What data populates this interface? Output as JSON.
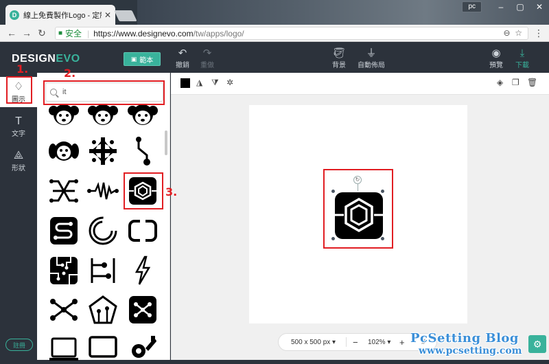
{
  "browser": {
    "tab_title": "線上免費製作Logo - 定制...",
    "favicon_letter": "D",
    "user_label": "pc",
    "secure_label": "安全",
    "url_host": "https://www.designevo.com",
    "url_path": "/tw/apps/logo/"
  },
  "app": {
    "brand_left": "DESIGN",
    "brand_right": "EVO",
    "save_label": "範本",
    "undo_label": "撤銷",
    "redo_label": "重做",
    "background_label": "背景",
    "autolayout_label": "自動佈局",
    "preview_label": "預覽",
    "download_label": "下載"
  },
  "rail": {
    "icon_label": "圖示",
    "text_label": "文字",
    "shape_label": "形狀",
    "signup_label": "註冊"
  },
  "search": {
    "value": "it"
  },
  "zoom": {
    "size_label": "500 x 500 px",
    "zoom_label": "102%"
  },
  "annotations": {
    "step1": "1.",
    "step2": "2.",
    "step3": "3."
  },
  "watermark": {
    "line1": "PcSetting Blog",
    "line2": "www.pcsetting.com"
  },
  "colors": {
    "accent": "#39b29b",
    "dark": "#2c323b",
    "annotation": "#e11d22"
  }
}
